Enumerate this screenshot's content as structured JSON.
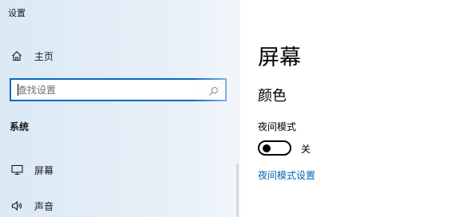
{
  "window": {
    "title": "设置"
  },
  "sidebar": {
    "home": {
      "label": "主页",
      "icon": "home-icon"
    },
    "search": {
      "placeholder": "查找设置",
      "value": "",
      "icon": "search-icon"
    },
    "section_heading": "系统",
    "items": [
      {
        "label": "屏幕",
        "icon": "monitor-icon"
      },
      {
        "label": "声音",
        "icon": "speaker-icon"
      }
    ]
  },
  "main": {
    "title": "屏幕",
    "section": "颜色",
    "night_light": {
      "label": "夜间模式",
      "toggle_state": "关",
      "settings_link": "夜间模式设置"
    }
  },
  "colors": {
    "accent": "#0a66c4",
    "link": "#0066b4",
    "sidebar_bg": "#e4eef7"
  }
}
